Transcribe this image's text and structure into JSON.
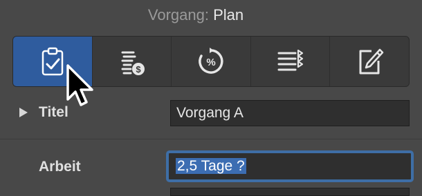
{
  "header": {
    "label": "Vorgang:",
    "value": "Plan"
  },
  "toolbar": {
    "tabs": [
      {
        "icon": "clipboard-check-icon",
        "active": true
      },
      {
        "icon": "cost-stack-icon",
        "active": false
      },
      {
        "icon": "percent-progress-icon",
        "active": false
      },
      {
        "icon": "list-arrows-icon",
        "active": false
      },
      {
        "icon": "notes-edit-icon",
        "active": false
      }
    ],
    "active_color": "#2f5c9e"
  },
  "fields": {
    "title": {
      "label": "Titel",
      "value": "Vorgang A"
    },
    "work": {
      "label": "Arbeit",
      "value": "2,5 Tage ?"
    }
  },
  "colors": {
    "background": "#484848",
    "focus_ring": "#3e6ea6",
    "selection": "#3c6db2"
  }
}
